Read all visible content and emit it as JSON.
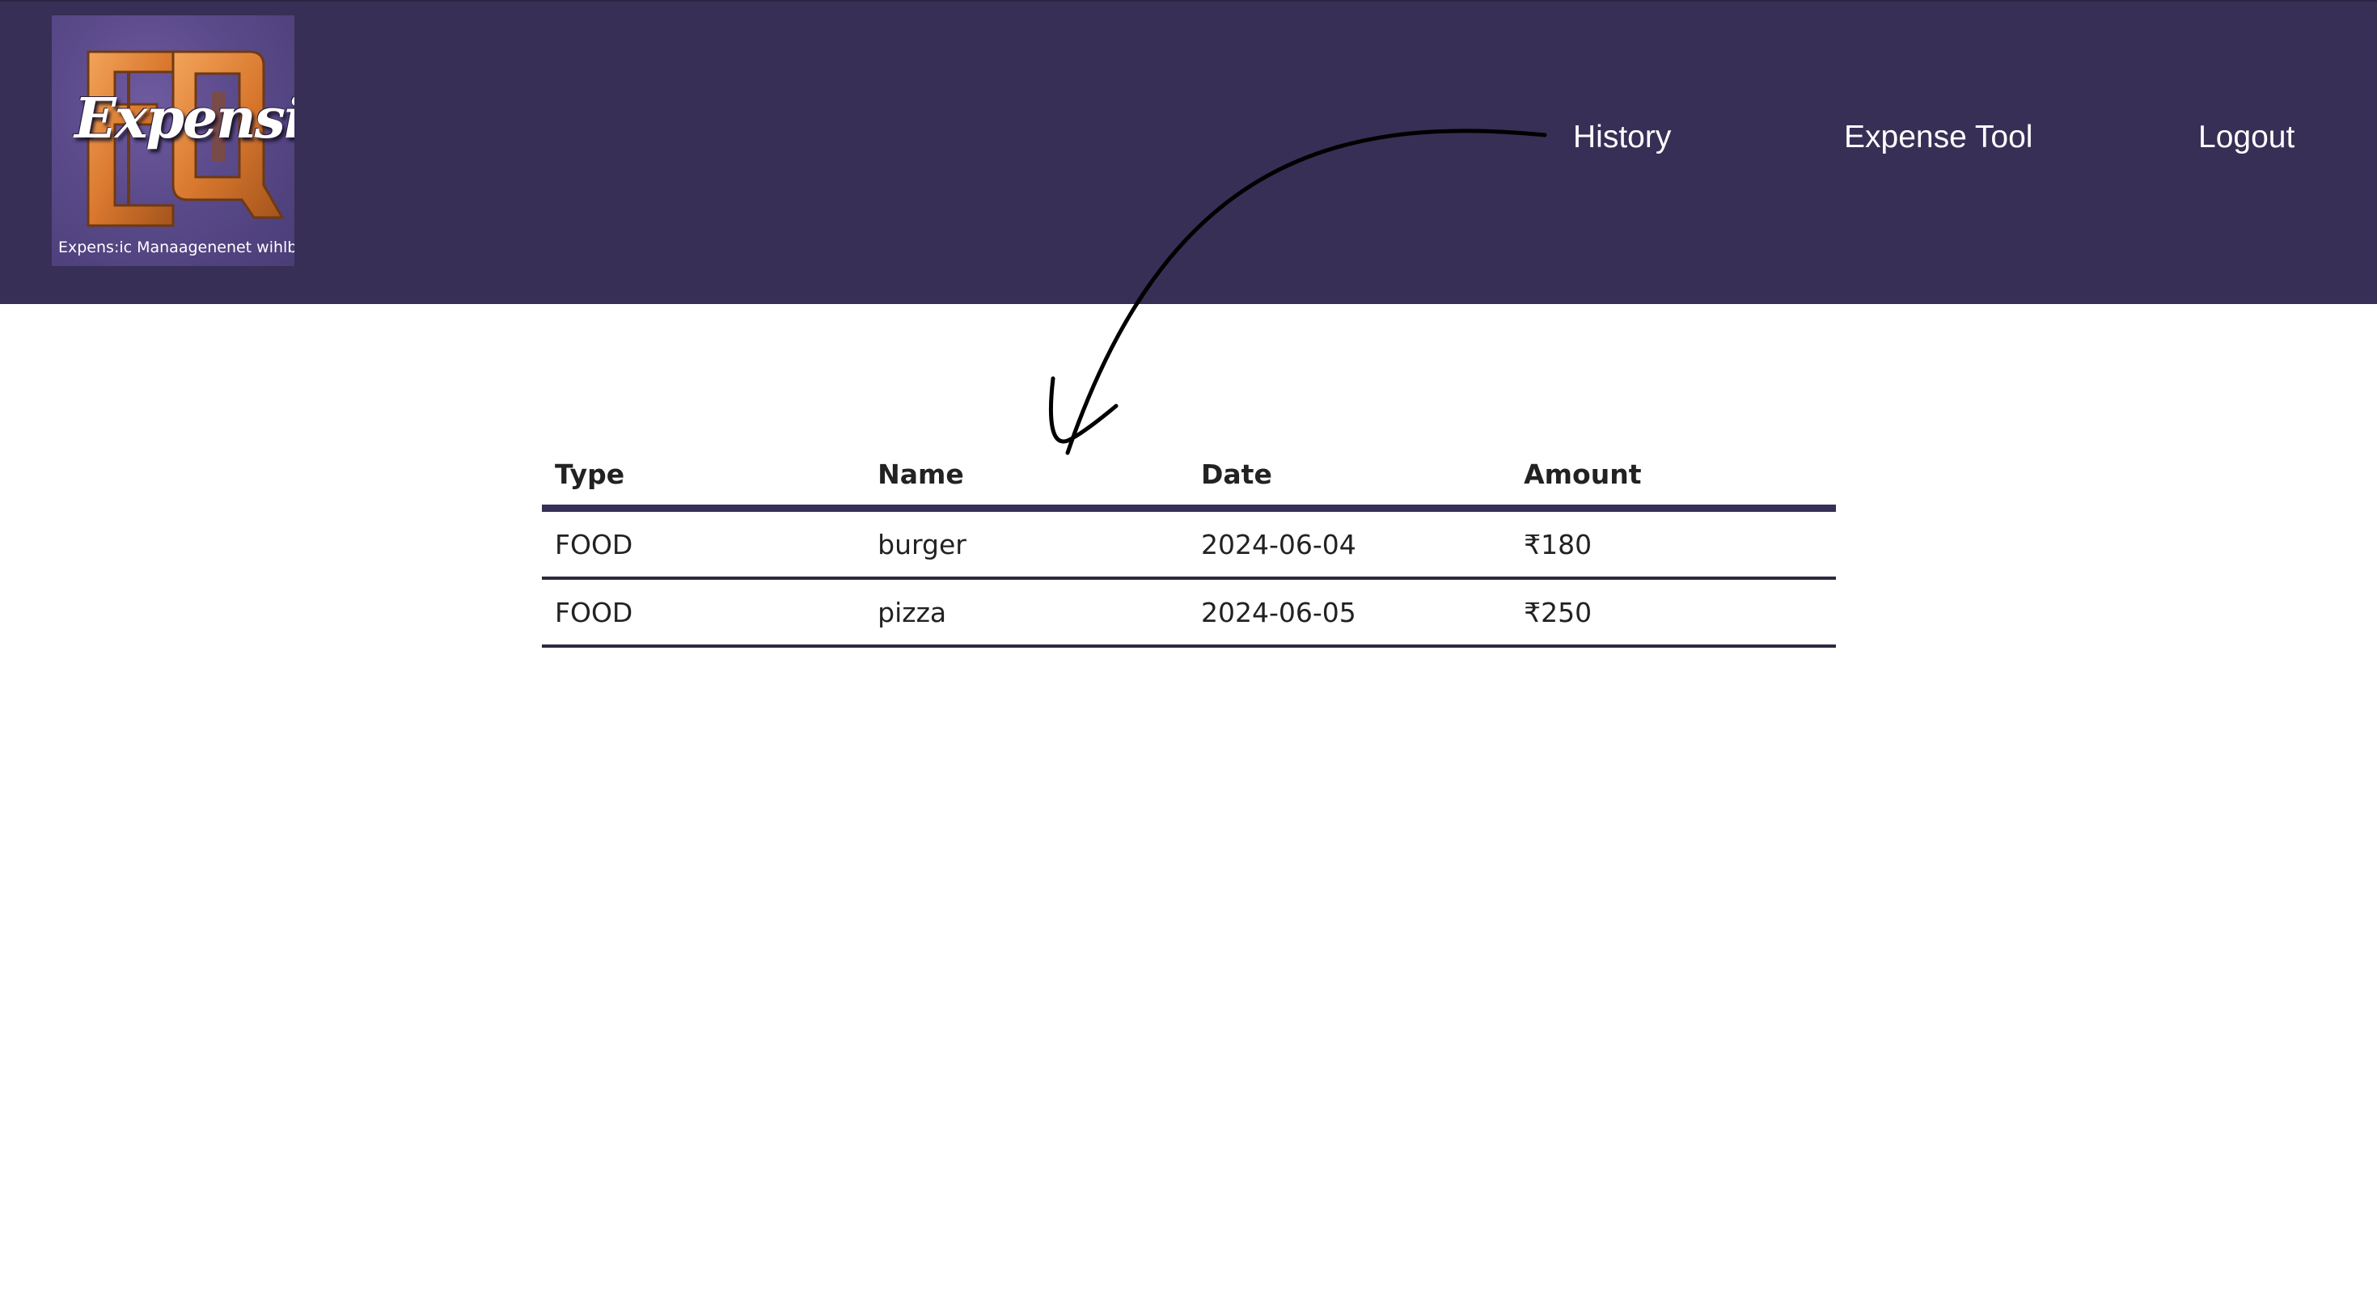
{
  "header": {
    "logo": {
      "wordmark": "Expensio",
      "tagline": "Expens:ic Manaagenenet wihlbet"
    },
    "nav": [
      {
        "label": "History"
      },
      {
        "label": "Expense Tool"
      },
      {
        "label": "Logout"
      }
    ]
  },
  "table": {
    "columns": [
      "Type",
      "Name",
      "Date",
      "Amount"
    ],
    "rows": [
      {
        "type": "FOOD",
        "name": "burger",
        "date": "2024-06-04",
        "amount": "₹180"
      },
      {
        "type": "FOOD",
        "name": "pizza",
        "date": "2024-06-05",
        "amount": "₹250"
      }
    ]
  },
  "colors": {
    "header_bg": "#372f55",
    "logo_bg": "#5a4a8a",
    "logo_accent": "#e0883a",
    "text_dark": "#222222"
  },
  "icons": [
    "annotation-arrow"
  ]
}
